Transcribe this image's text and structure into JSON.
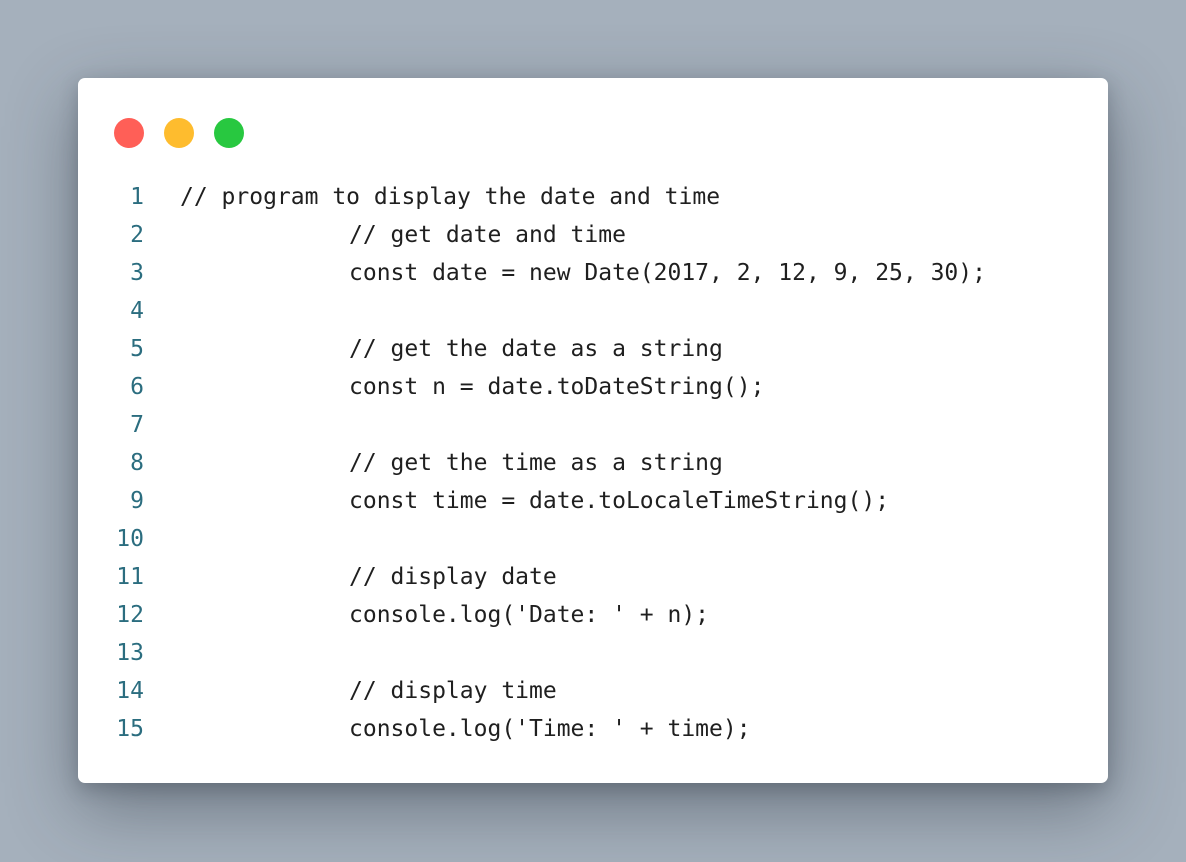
{
  "window": {
    "controls": [
      {
        "name": "close",
        "color": "#ff5f57"
      },
      {
        "name": "minimize",
        "color": "#febc2e"
      },
      {
        "name": "zoom",
        "color": "#28c840"
      }
    ]
  },
  "code": {
    "lines": [
      {
        "number": "1",
        "text": "// program to display the date and time",
        "indent": 0
      },
      {
        "number": "2",
        "text": "// get date and time",
        "indent": 1
      },
      {
        "number": "3",
        "text": "const date = new Date(2017, 2, 12, 9, 25, 30);",
        "indent": 1
      },
      {
        "number": "4",
        "text": "",
        "indent": 0
      },
      {
        "number": "5",
        "text": "// get the date as a string",
        "indent": 1
      },
      {
        "number": "6",
        "text": "const n = date.toDateString();",
        "indent": 1
      },
      {
        "number": "7",
        "text": "",
        "indent": 0
      },
      {
        "number": "8",
        "text": "// get the time as a string",
        "indent": 1
      },
      {
        "number": "9",
        "text": "const time = date.toLocaleTimeString();",
        "indent": 1
      },
      {
        "number": "10",
        "text": "",
        "indent": 0
      },
      {
        "number": "11",
        "text": "// display date",
        "indent": 1
      },
      {
        "number": "12",
        "text": "console.log('Date: ' + n);",
        "indent": 1
      },
      {
        "number": "13",
        "text": "",
        "indent": 0
      },
      {
        "number": "14",
        "text": "// display time",
        "indent": 1
      },
      {
        "number": "15",
        "text": "console.log('Time: ' + time);",
        "indent": 1
      }
    ]
  }
}
